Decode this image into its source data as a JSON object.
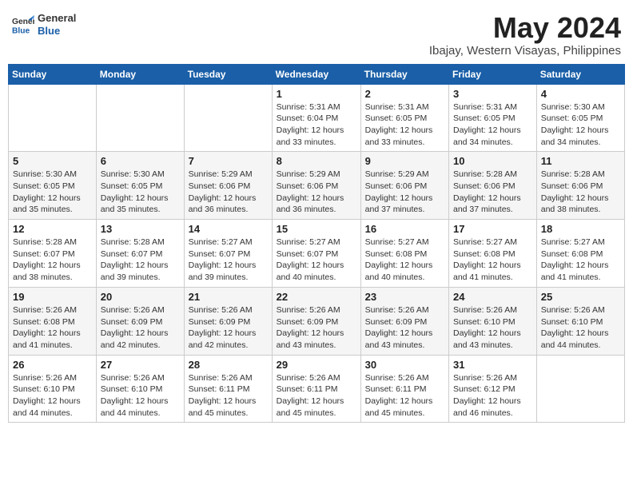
{
  "header": {
    "logo_general": "General",
    "logo_blue": "Blue",
    "month": "May 2024",
    "location": "Ibajay, Western Visayas, Philippines"
  },
  "days_of_week": [
    "Sunday",
    "Monday",
    "Tuesday",
    "Wednesday",
    "Thursday",
    "Friday",
    "Saturday"
  ],
  "weeks": [
    [
      {
        "day": "",
        "info": ""
      },
      {
        "day": "",
        "info": ""
      },
      {
        "day": "",
        "info": ""
      },
      {
        "day": "1",
        "info": "Sunrise: 5:31 AM\nSunset: 6:04 PM\nDaylight: 12 hours\nand 33 minutes."
      },
      {
        "day": "2",
        "info": "Sunrise: 5:31 AM\nSunset: 6:05 PM\nDaylight: 12 hours\nand 33 minutes."
      },
      {
        "day": "3",
        "info": "Sunrise: 5:31 AM\nSunset: 6:05 PM\nDaylight: 12 hours\nand 34 minutes."
      },
      {
        "day": "4",
        "info": "Sunrise: 5:30 AM\nSunset: 6:05 PM\nDaylight: 12 hours\nand 34 minutes."
      }
    ],
    [
      {
        "day": "5",
        "info": "Sunrise: 5:30 AM\nSunset: 6:05 PM\nDaylight: 12 hours\nand 35 minutes."
      },
      {
        "day": "6",
        "info": "Sunrise: 5:30 AM\nSunset: 6:05 PM\nDaylight: 12 hours\nand 35 minutes."
      },
      {
        "day": "7",
        "info": "Sunrise: 5:29 AM\nSunset: 6:06 PM\nDaylight: 12 hours\nand 36 minutes."
      },
      {
        "day": "8",
        "info": "Sunrise: 5:29 AM\nSunset: 6:06 PM\nDaylight: 12 hours\nand 36 minutes."
      },
      {
        "day": "9",
        "info": "Sunrise: 5:29 AM\nSunset: 6:06 PM\nDaylight: 12 hours\nand 37 minutes."
      },
      {
        "day": "10",
        "info": "Sunrise: 5:28 AM\nSunset: 6:06 PM\nDaylight: 12 hours\nand 37 minutes."
      },
      {
        "day": "11",
        "info": "Sunrise: 5:28 AM\nSunset: 6:06 PM\nDaylight: 12 hours\nand 38 minutes."
      }
    ],
    [
      {
        "day": "12",
        "info": "Sunrise: 5:28 AM\nSunset: 6:07 PM\nDaylight: 12 hours\nand 38 minutes."
      },
      {
        "day": "13",
        "info": "Sunrise: 5:28 AM\nSunset: 6:07 PM\nDaylight: 12 hours\nand 39 minutes."
      },
      {
        "day": "14",
        "info": "Sunrise: 5:27 AM\nSunset: 6:07 PM\nDaylight: 12 hours\nand 39 minutes."
      },
      {
        "day": "15",
        "info": "Sunrise: 5:27 AM\nSunset: 6:07 PM\nDaylight: 12 hours\nand 40 minutes."
      },
      {
        "day": "16",
        "info": "Sunrise: 5:27 AM\nSunset: 6:08 PM\nDaylight: 12 hours\nand 40 minutes."
      },
      {
        "day": "17",
        "info": "Sunrise: 5:27 AM\nSunset: 6:08 PM\nDaylight: 12 hours\nand 41 minutes."
      },
      {
        "day": "18",
        "info": "Sunrise: 5:27 AM\nSunset: 6:08 PM\nDaylight: 12 hours\nand 41 minutes."
      }
    ],
    [
      {
        "day": "19",
        "info": "Sunrise: 5:26 AM\nSunset: 6:08 PM\nDaylight: 12 hours\nand 41 minutes."
      },
      {
        "day": "20",
        "info": "Sunrise: 5:26 AM\nSunset: 6:09 PM\nDaylight: 12 hours\nand 42 minutes."
      },
      {
        "day": "21",
        "info": "Sunrise: 5:26 AM\nSunset: 6:09 PM\nDaylight: 12 hours\nand 42 minutes."
      },
      {
        "day": "22",
        "info": "Sunrise: 5:26 AM\nSunset: 6:09 PM\nDaylight: 12 hours\nand 43 minutes."
      },
      {
        "day": "23",
        "info": "Sunrise: 5:26 AM\nSunset: 6:09 PM\nDaylight: 12 hours\nand 43 minutes."
      },
      {
        "day": "24",
        "info": "Sunrise: 5:26 AM\nSunset: 6:10 PM\nDaylight: 12 hours\nand 43 minutes."
      },
      {
        "day": "25",
        "info": "Sunrise: 5:26 AM\nSunset: 6:10 PM\nDaylight: 12 hours\nand 44 minutes."
      }
    ],
    [
      {
        "day": "26",
        "info": "Sunrise: 5:26 AM\nSunset: 6:10 PM\nDaylight: 12 hours\nand 44 minutes."
      },
      {
        "day": "27",
        "info": "Sunrise: 5:26 AM\nSunset: 6:10 PM\nDaylight: 12 hours\nand 44 minutes."
      },
      {
        "day": "28",
        "info": "Sunrise: 5:26 AM\nSunset: 6:11 PM\nDaylight: 12 hours\nand 45 minutes."
      },
      {
        "day": "29",
        "info": "Sunrise: 5:26 AM\nSunset: 6:11 PM\nDaylight: 12 hours\nand 45 minutes."
      },
      {
        "day": "30",
        "info": "Sunrise: 5:26 AM\nSunset: 6:11 PM\nDaylight: 12 hours\nand 45 minutes."
      },
      {
        "day": "31",
        "info": "Sunrise: 5:26 AM\nSunset: 6:12 PM\nDaylight: 12 hours\nand 46 minutes."
      },
      {
        "day": "",
        "info": ""
      }
    ]
  ]
}
